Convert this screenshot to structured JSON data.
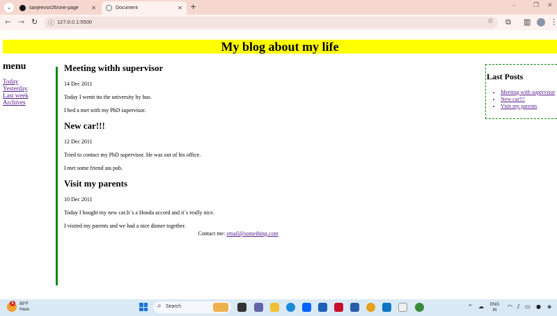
{
  "browser": {
    "tabs": [
      {
        "title": "sanjeevsri26/one-page",
        "close": "✕",
        "active": false
      },
      {
        "title": "Document",
        "close": "✕",
        "active": true
      }
    ],
    "url": "127.0.0.1:5500"
  },
  "page": {
    "header": "My blog about my life",
    "menu": {
      "title": "menu",
      "links": [
        "Today",
        "Yesterday",
        "Last week",
        "Archives"
      ]
    },
    "posts": [
      {
        "title": "Meeting withh supervisor",
        "date": "14 Dec 2011",
        "paragraphs": [
          "Today I wentt tto the university by bus.",
          "I hed a met with my PhD supervisor."
        ]
      },
      {
        "title": "New car!!!",
        "date": "12 Dec 2011",
        "paragraphs": [
          "Tried to contact my PhD supervisor. He was out of his office.",
          "I met some friend ata pub."
        ]
      },
      {
        "title": "Visit my parents",
        "date": "10 Dec 2011",
        "paragraphs": [
          "Today I bought my new car.It`s a Honda accord and it`s really nice.",
          "I visited my parents and we had a nice dinner together."
        ]
      }
    ],
    "contact": {
      "label": "Contact me:",
      "email": "email@something.com"
    },
    "last_posts": {
      "title": "Last Posts",
      "items": [
        "Meeting with supervisor",
        "New car!!!",
        "Visit my parents"
      ]
    }
  },
  "taskbar": {
    "weather": {
      "temp": "89°F",
      "condition": "Haze",
      "badge": "1"
    },
    "search_label": "Search",
    "lang": [
      "ENG",
      "IN"
    ]
  }
}
